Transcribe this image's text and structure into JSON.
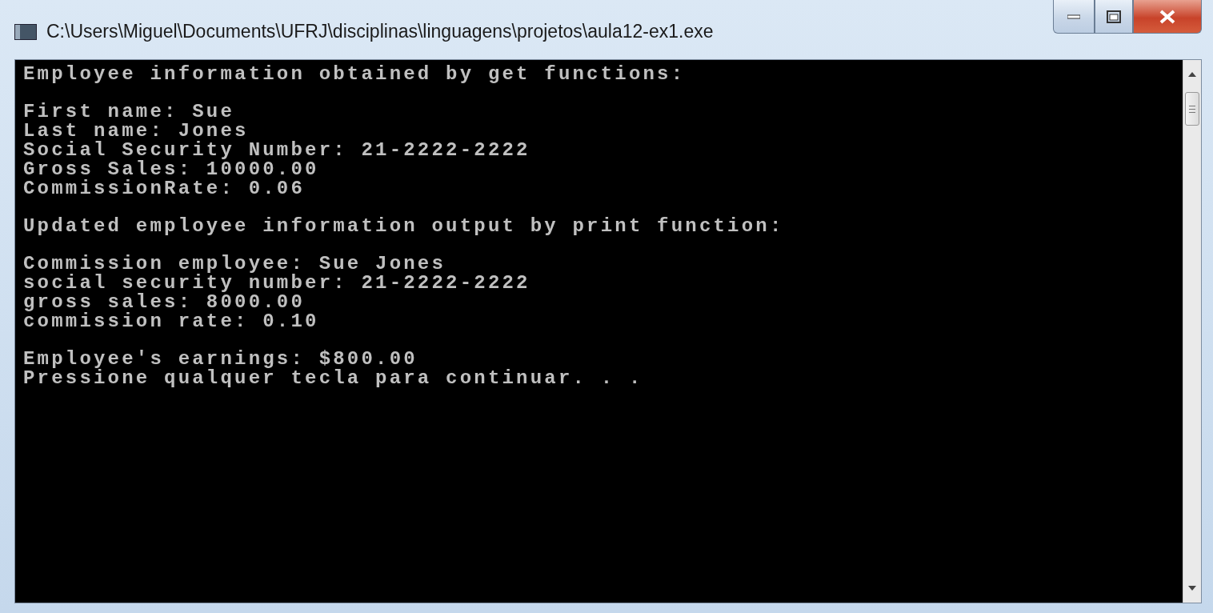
{
  "window": {
    "title": "C:\\Users\\Miguel\\Documents\\UFRJ\\disciplinas\\linguagens\\projetos\\aula12-ex1.exe"
  },
  "console": {
    "blocks": [
      [
        "Employee information obtained by get functions:"
      ],
      [
        "First name: Sue",
        "Last name: Jones",
        "Social Security Number: 21-2222-2222",
        "Gross Sales: 10000.00",
        "CommissionRate: 0.06"
      ],
      [
        "Updated employee information output by print function:"
      ],
      [
        "Commission employee: Sue Jones",
        "social security number: 21-2222-2222",
        "gross sales: 8000.00",
        "commission rate: 0.10"
      ],
      [
        "Employee's earnings: $800.00",
        "Pressione qualquer tecla para continuar. . ."
      ]
    ]
  }
}
